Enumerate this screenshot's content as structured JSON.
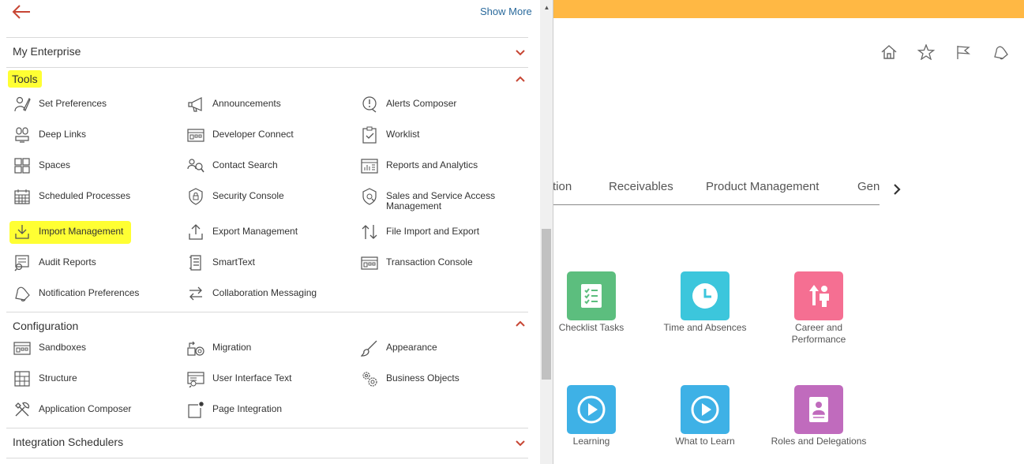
{
  "navigator": {
    "show_more": "Show More",
    "sections": {
      "my_enterprise": "My Enterprise",
      "tools": "Tools",
      "configuration": "Configuration",
      "integration_schedulers": "Integration Schedulers"
    },
    "tools": [
      {
        "label": "Set Preferences",
        "icon": "set-preferences-icon"
      },
      {
        "label": "Announcements",
        "icon": "megaphone-icon"
      },
      {
        "label": "Alerts Composer",
        "icon": "alert-icon"
      },
      {
        "label": "Deep Links",
        "icon": "deep-links-icon"
      },
      {
        "label": "Developer Connect",
        "icon": "developer-connect-icon"
      },
      {
        "label": "Worklist",
        "icon": "worklist-icon"
      },
      {
        "label": "Spaces",
        "icon": "spaces-icon"
      },
      {
        "label": "Contact Search",
        "icon": "contact-search-icon"
      },
      {
        "label": "Reports and Analytics",
        "icon": "reports-icon"
      },
      {
        "label": "Scheduled Processes",
        "icon": "calendar-icon"
      },
      {
        "label": "Security Console",
        "icon": "lock-icon"
      },
      {
        "label": "Sales and Service Access Management",
        "icon": "shield-gear-icon"
      },
      {
        "label": "Import Management",
        "icon": "import-icon"
      },
      {
        "label": "Export Management",
        "icon": "export-icon"
      },
      {
        "label": "File Import and Export",
        "icon": "file-import-export-icon"
      },
      {
        "label": "Audit Reports",
        "icon": "audit-reports-icon"
      },
      {
        "label": "SmartText",
        "icon": "smarttext-icon"
      },
      {
        "label": "Transaction Console",
        "icon": "transaction-console-icon"
      },
      {
        "label": "Notification Preferences",
        "icon": "bell-icon"
      },
      {
        "label": "Collaboration Messaging",
        "icon": "messaging-icon"
      }
    ],
    "configuration": [
      {
        "label": "Sandboxes",
        "icon": "sandbox-icon"
      },
      {
        "label": "Migration",
        "icon": "migration-icon"
      },
      {
        "label": "Appearance",
        "icon": "brush-icon"
      },
      {
        "label": "Structure",
        "icon": "structure-icon"
      },
      {
        "label": "User Interface Text",
        "icon": "ui-text-icon"
      },
      {
        "label": "Business Objects",
        "icon": "gears-icon"
      },
      {
        "label": "Application Composer",
        "icon": "tools-icon"
      },
      {
        "label": "Page Integration",
        "icon": "page-integration-icon"
      }
    ]
  },
  "app": {
    "tabs": [
      "tion",
      "Receivables",
      "Product Management",
      "Gen"
    ],
    "tiles": [
      {
        "label": "Checklist Tasks",
        "color": "#5cbe7e",
        "icon": "checklist-icon"
      },
      {
        "label": "Time and Absences",
        "color": "#3cc6dc",
        "icon": "clock-icon"
      },
      {
        "label": "Career and Performance",
        "color": "#f56f92",
        "icon": "career-icon"
      },
      {
        "label": "Learning",
        "color": "#3eb1e6",
        "icon": "play-icon"
      },
      {
        "label": "What to Learn",
        "color": "#3eb1e6",
        "icon": "play-icon"
      },
      {
        "label": "Roles and Delegations",
        "color": "#c06bbd",
        "icon": "badge-icon"
      }
    ],
    "banner_color": "#ffb844",
    "accent_color": "#c74634",
    "highlight_color": "#ffff33"
  }
}
